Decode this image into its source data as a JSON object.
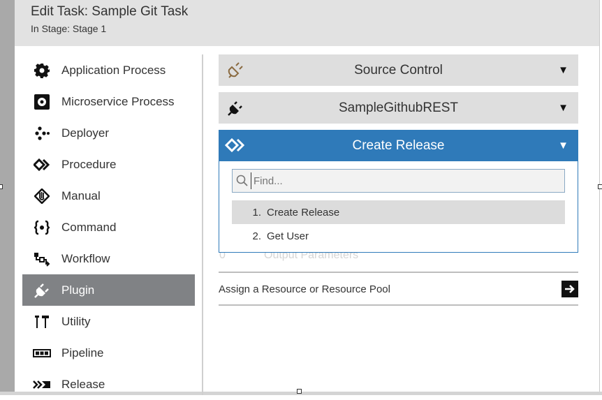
{
  "header": {
    "title": "Edit Task: Sample Git Task",
    "subtitle": "In Stage: Stage 1"
  },
  "sidebar": {
    "items": [
      {
        "label": "Application Process",
        "icon": "gear-icon",
        "active": false
      },
      {
        "label": "Microservice Process",
        "icon": "microservice-gear-icon",
        "active": false
      },
      {
        "label": "Deployer",
        "icon": "deployer-icon",
        "active": false
      },
      {
        "label": "Procedure",
        "icon": "procedure-icon",
        "active": false
      },
      {
        "label": "Manual",
        "icon": "hand-icon",
        "active": false
      },
      {
        "label": "Command",
        "icon": "command-icon",
        "active": false
      },
      {
        "label": "Workflow",
        "icon": "workflow-icon",
        "active": false
      },
      {
        "label": "Plugin",
        "icon": "plug-icon",
        "active": true
      },
      {
        "label": "Utility",
        "icon": "tools-icon",
        "active": false
      },
      {
        "label": "Pipeline",
        "icon": "pipeline-icon",
        "active": false
      },
      {
        "label": "Release",
        "icon": "release-icon",
        "active": false
      }
    ]
  },
  "panels": {
    "source_control": "Source Control",
    "config": "SampleGithubREST",
    "action": "Create Release"
  },
  "dropdown": {
    "search_placeholder": "Find...",
    "options": [
      {
        "num": "1.",
        "label": "Create Release"
      },
      {
        "num": "2.",
        "label": "Get User"
      }
    ]
  },
  "behind_row": {
    "count": "0",
    "label": "Output Parameters"
  },
  "assign": {
    "label": "Assign a Resource or Resource Pool"
  },
  "colors": {
    "accent": "#2f7ab9",
    "active_item": "#808285",
    "header_bg": "#e2e2e2"
  }
}
